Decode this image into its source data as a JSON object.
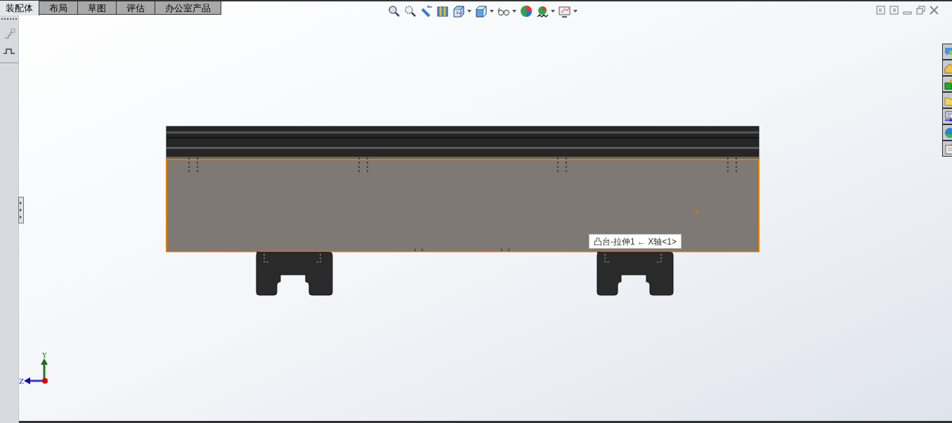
{
  "tabs": [
    {
      "label": "装配体",
      "selected": true
    },
    {
      "label": "布局",
      "selected": false
    },
    {
      "label": "草图",
      "selected": false
    },
    {
      "label": "评估",
      "selected": false
    },
    {
      "label": "办公室产品",
      "selected": false
    }
  ],
  "side_toolbar": [
    {
      "kind": "mate"
    },
    {
      "kind": "step"
    }
  ],
  "view_toolbar": [
    {
      "kind": "zoom-fit",
      "dropdown": false
    },
    {
      "kind": "zoom-area",
      "dropdown": false
    },
    {
      "kind": "previous-view",
      "dropdown": false
    },
    {
      "kind": "section",
      "dropdown": false
    },
    {
      "kind": "view-orientation",
      "dropdown": true
    },
    {
      "kind": "display-style",
      "dropdown": true
    },
    {
      "kind": "hide-show",
      "dropdown": true
    },
    {
      "kind": "appearance",
      "dropdown": false
    },
    {
      "kind": "scene",
      "dropdown": true
    },
    {
      "kind": "view-settings",
      "dropdown": true
    }
  ],
  "window_controls": [
    {
      "kind": "tile-left"
    },
    {
      "kind": "tile-right"
    },
    {
      "kind": "minimize"
    },
    {
      "kind": "restore"
    },
    {
      "kind": "close"
    }
  ],
  "task_pane": [
    {
      "kind": "resources"
    },
    {
      "kind": "library"
    },
    {
      "kind": "toolbox"
    },
    {
      "kind": "file-explorer"
    },
    {
      "kind": "palette"
    },
    {
      "kind": "appearances"
    },
    {
      "kind": "properties"
    }
  ],
  "tooltip": "凸台-拉伸1 ← X轴<1>",
  "triad": {
    "y_label": "Y",
    "z_label": "Z"
  }
}
